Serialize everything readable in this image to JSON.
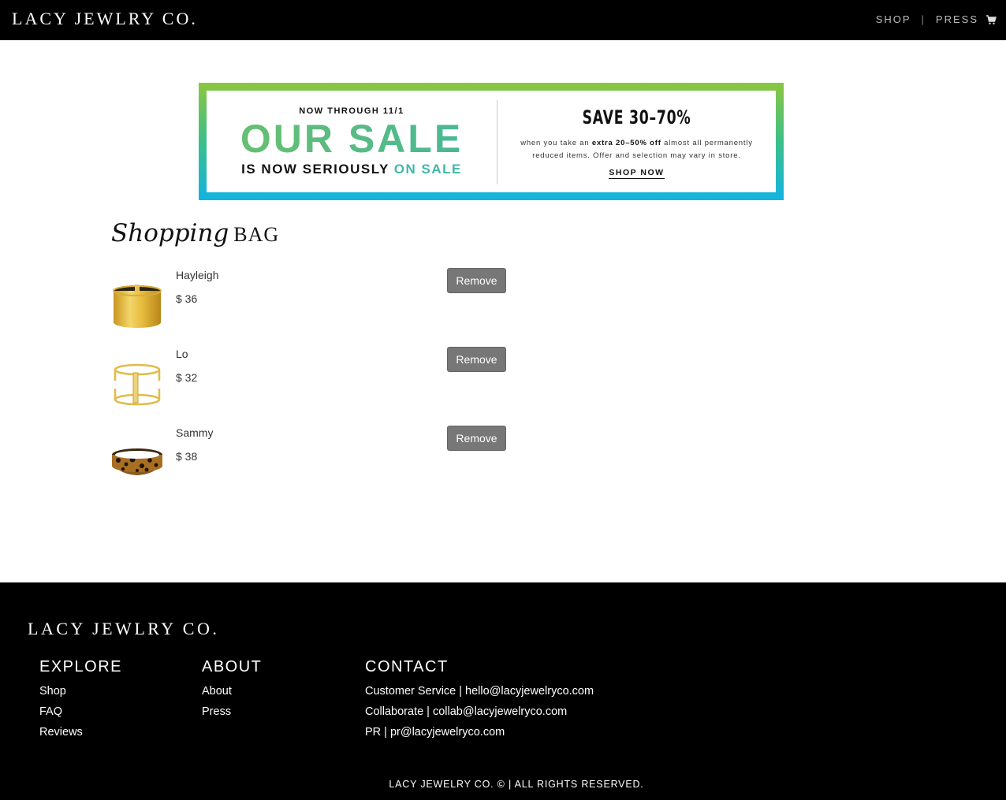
{
  "header": {
    "brand": "LACY JEWLRY CO.",
    "nav": {
      "shop": "SHOP",
      "separator": "|",
      "press": "PRESS"
    },
    "cart_icon": "cart-icon"
  },
  "banner": {
    "now_through": "NOW THROUGH 11/1",
    "headline": "OUR SALE",
    "subline_prefix": "IS NOW SERIOUSLY ",
    "subline_accent": "ON SALE",
    "save": "SAVE 30–70%",
    "when_prefix": "when you take an ",
    "when_bold": "extra 20–50% off",
    "when_suffix": " almost all permanently reduced items. Offer and selection may vary in store.",
    "cta": "SHOP NOW",
    "colors": {
      "gradient_top": "#8cc63f",
      "gradient_bottom": "#11b4e2",
      "accent": "#3fb8a9"
    }
  },
  "bag": {
    "title_script": "Shopping",
    "title_caps": "BAG",
    "items": [
      {
        "name": "Hayleigh",
        "price": "$ 36",
        "remove_label": "Remove",
        "image": "gold-cuff-bracelet"
      },
      {
        "name": "Lo",
        "price": "$ 32",
        "remove_label": "Remove",
        "image": "open-gold-cuff-bracelet"
      },
      {
        "name": "Sammy",
        "price": "$ 38",
        "remove_label": "Remove",
        "image": "tortoise-cuff-bracelet"
      }
    ]
  },
  "footer": {
    "brand": "LACY JEWLRY CO.",
    "explore": {
      "heading": "EXPLORE",
      "links": [
        "Shop",
        "FAQ",
        "Reviews"
      ]
    },
    "about": {
      "heading": "ABOUT",
      "links": [
        "About",
        "Press"
      ]
    },
    "contact": {
      "heading": "CONTACT",
      "links": [
        "Customer Service | hello@lacyjewelryco.com",
        "Collaborate | collab@lacyjewelryco.com",
        "PR | pr@lacyjewelryco.com"
      ]
    },
    "copyright": "LACY JEWELRY CO. © | ALL RIGHTS RESERVED."
  }
}
